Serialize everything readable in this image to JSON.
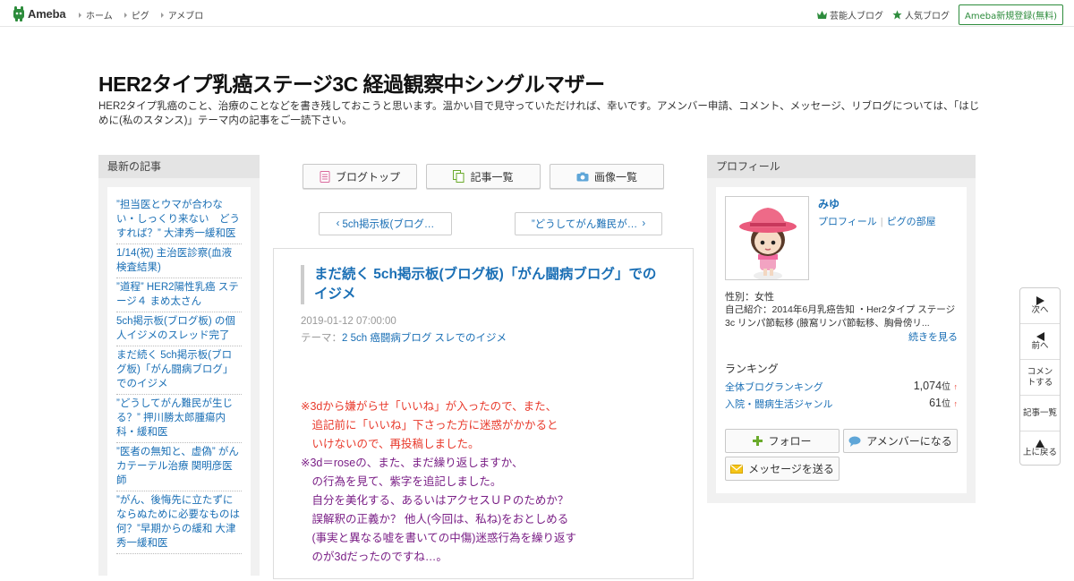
{
  "header": {
    "logo_text": "Ameba",
    "nav": [
      "ホーム",
      "ピグ",
      "アメブロ"
    ],
    "right_links": [
      {
        "label": "芸能人ブログ",
        "icon": "crown-icon"
      },
      {
        "label": "人気ブログ",
        "icon": "star-icon"
      }
    ],
    "register_label": "Ameba新規登録(無料)"
  },
  "blog": {
    "title": "HER2タイプ乳癌ステージ3C 経過観察中シングルマザー",
    "description": "HER2タイプ乳癌のこと、治療のことなどを書き残しておこうと思います。温かい目で見守っていただければ、幸いです。アメンバー申請、コメント、メッセージ、リブログについては、「はじめに(私のスタンス)」テーマ内の記事をご一読下さい。"
  },
  "left": {
    "heading": "最新の記事",
    "items": [
      "”担当医とウマが合わない・しっくり来ない　どうすれば？” 大津秀一緩和医",
      "1/14(祝) 主治医診察(血液検査結果)",
      "”道程” HER2陽性乳癌 ステージ４ まめ太さん",
      "5ch掲示板(ブログ板) の個人イジメのスレッド完了",
      "まだ続く 5ch掲示板(ブログ板)「がん闘病ブログ」でのイジメ",
      "”どうしてがん難民が生じる？” 押川勝太郎腫瘍内科・緩和医",
      "”医者の無知と、虚偽” がんカテーテル治療 関明彦医師",
      "”がん、後悔先に立たずにならぬために必要なものは何？”早期からの緩和 大津秀一緩和医"
    ]
  },
  "center": {
    "buttons": [
      {
        "label": "ブログトップ",
        "icon": "document-icon"
      },
      {
        "label": "記事一覧",
        "icon": "copy-icon"
      },
      {
        "label": "画像一覧",
        "icon": "camera-icon"
      }
    ],
    "prev_label": "5ch掲示板(ブログ…",
    "next_label": "”どうしてがん難民が…"
  },
  "article": {
    "title": "まだ続く 5ch掲示板(ブログ板)「がん闘病ブログ」でのイジメ",
    "date": "2019-01-12 07:00:00",
    "theme_prefix": "テーマ：",
    "theme": "2 5ch 癌闘病ブログ スレでのイジメ",
    "lines": [
      {
        "text": "※3dから嫌がらせ「いいね」が入ったので、また、",
        "color": "red"
      },
      {
        "text": "　追記前に「いいね」下さった方に迷惑がかかると",
        "color": "red"
      },
      {
        "text": "　いけないので、再投稿しました。",
        "color": "red"
      },
      {
        "text": "※3d＝roseの、また、まだ繰り返しますか、",
        "color": "purple"
      },
      {
        "text": "　の行為を見て、紫字を追記しました。",
        "color": "purple"
      },
      {
        "text": "　自分を美化する、あるいはアクセスＵＰのためか？",
        "color": "purple"
      },
      {
        "text": "　誤解釈の正義か？ 他人(今回は、私ね)をおとしめる",
        "color": "purple"
      },
      {
        "text": "　(事実と異なる嘘を書いての中傷)迷惑行為を繰り返す",
        "color": "purple"
      },
      {
        "text": "　のが3dだったのですね…。",
        "color": "purple"
      }
    ]
  },
  "profile": {
    "heading": "プロフィール",
    "name": "みゆ",
    "link_profile": "プロフィール",
    "link_room": "ピグの部屋",
    "gender": "性別：女性",
    "intro": "自己紹介：2014年6月乳癌告知 ・Her2タイプ ステージ3c リンパ節転移 (腋窩リンパ節転移、胸骨傍リ...",
    "more": "続きを見る",
    "ranking_label": "ランキング",
    "rankings": [
      {
        "name": "全体ブログランキング",
        "value": "1,074",
        "unit": "位",
        "arrow": "↑"
      },
      {
        "name": "入院・闘病生活ジャンル",
        "value": "61",
        "unit": "位",
        "arrow": "↑"
      }
    ],
    "follow_label": "フォロー",
    "amember_label": "アメンバーになる",
    "message_label": "メッセージを送る"
  },
  "float_nav": {
    "next": "次へ",
    "prev": "前へ",
    "comment": "コメントする",
    "list": "記事一覧",
    "top": "上に戻る"
  },
  "colors": {
    "link": "#1a6fb5",
    "brand_green": "#2d8c3c",
    "red_text": "#e8392b",
    "purple_text": "#7a1f86"
  }
}
